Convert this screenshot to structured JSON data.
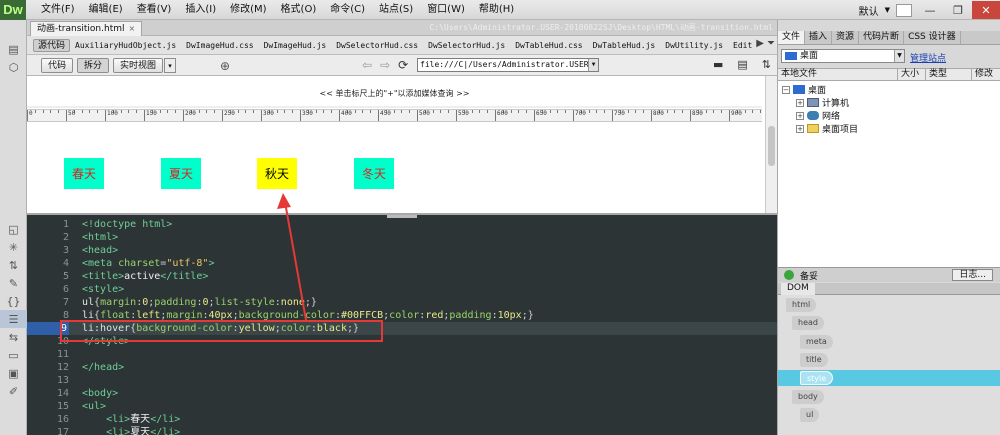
{
  "app": {
    "logo": "Dw",
    "menus": [
      "文件(F)",
      "编辑(E)",
      "查看(V)",
      "插入(I)",
      "修改(M)",
      "格式(O)",
      "命令(C)",
      "站点(S)",
      "窗口(W)",
      "帮助(H)"
    ],
    "workspace": "默认",
    "window_controls": [
      "—",
      "❐",
      "✕"
    ]
  },
  "document": {
    "tab_label": "动画-transition.html",
    "close_glyph": "×",
    "path": "C:\\Users\\Administrator.USER-20180822SJ\\Desktop\\HTML\\动画-transition.html",
    "source_button": "源代码",
    "related_files": [
      "AuxiliaryHudObject.js",
      "DwImageHud.css",
      "DwImageHud.js",
      "DwSelectorHud.css",
      "DwSelectorHud.js",
      "DwTableHud.css",
      "DwTableHud.js",
      "DwUtility.js",
      "Edit"
    ],
    "view_buttons": [
      "代码",
      "拆分",
      "实时视图"
    ],
    "view_dropdown": "▾",
    "url": "file:///C|/Users/Administrator.USER-20",
    "mq_hint": "<< 单击标尺上的\"+\"以添加媒体查询 >>"
  },
  "ruler": {
    "labels": [
      "0",
      "50",
      "100",
      "150",
      "200",
      "250",
      "300",
      "350",
      "400",
      "450",
      "500",
      "550",
      "600",
      "650",
      "700",
      "750",
      "800",
      "850",
      "900",
      "950"
    ]
  },
  "rendered_list": {
    "items": [
      {
        "text": "春天",
        "bg": "#00FFCB",
        "color": "#e02020"
      },
      {
        "text": "夏天",
        "bg": "#00FFCB",
        "color": "#e02020"
      },
      {
        "text": "秋天",
        "bg": "#FFFF00",
        "color": "#000000"
      },
      {
        "text": "冬天",
        "bg": "#00FFCB",
        "color": "#e02020"
      }
    ]
  },
  "code": {
    "highlight_line": 9,
    "lines": [
      {
        "n": "1",
        "segs": [
          [
            "c-tag",
            "<!doctype html>"
          ]
        ]
      },
      {
        "n": "2",
        "segs": [
          [
            "c-tag",
            "<html>"
          ]
        ]
      },
      {
        "n": "3",
        "segs": [
          [
            "c-tag",
            "<head>"
          ]
        ]
      },
      {
        "n": "4",
        "segs": [
          [
            "c-tag",
            "<meta "
          ],
          [
            "c-prop",
            "charset"
          ],
          [
            "c-punc",
            "="
          ],
          [
            "c-str",
            "\"utf-8\""
          ],
          [
            "c-tag",
            ">"
          ]
        ]
      },
      {
        "n": "5",
        "segs": [
          [
            "c-tag",
            "<title>"
          ],
          [
            "c-txt",
            "active"
          ],
          [
            "c-tag",
            "</title>"
          ]
        ]
      },
      {
        "n": "6",
        "segs": [
          [
            "c-tag",
            "<style>"
          ]
        ]
      },
      {
        "n": "7",
        "segs": [
          [
            "c-name",
            "ul"
          ],
          [
            "c-punc",
            "{"
          ],
          [
            "c-prop",
            "margin"
          ],
          [
            "c-punc",
            ":"
          ],
          [
            "c-val",
            "0"
          ],
          [
            "c-punc",
            ";"
          ],
          [
            "c-prop",
            "padding"
          ],
          [
            "c-punc",
            ":"
          ],
          [
            "c-val",
            "0"
          ],
          [
            "c-punc",
            ";"
          ],
          [
            "c-prop",
            "list-style"
          ],
          [
            "c-punc",
            ":"
          ],
          [
            "c-val",
            "none"
          ],
          [
            "c-punc",
            ";}"
          ]
        ]
      },
      {
        "n": "8",
        "segs": [
          [
            "c-name",
            "li"
          ],
          [
            "c-punc",
            "{"
          ],
          [
            "c-prop",
            "float"
          ],
          [
            "c-punc",
            ":"
          ],
          [
            "c-val",
            "left"
          ],
          [
            "c-punc",
            ";"
          ],
          [
            "c-prop",
            "margin"
          ],
          [
            "c-punc",
            ":"
          ],
          [
            "c-val",
            "40px"
          ],
          [
            "c-punc",
            ";"
          ],
          [
            "c-prop",
            "background-color"
          ],
          [
            "c-punc",
            ":"
          ],
          [
            "c-val",
            "#00FFCB"
          ],
          [
            "c-punc",
            ";"
          ],
          [
            "c-prop",
            "color"
          ],
          [
            "c-punc",
            ":"
          ],
          [
            "c-val",
            "red"
          ],
          [
            "c-punc",
            ";"
          ],
          [
            "c-prop",
            "padding"
          ],
          [
            "c-punc",
            ":"
          ],
          [
            "c-val",
            "10px"
          ],
          [
            "c-punc",
            ";}"
          ]
        ]
      },
      {
        "n": "9",
        "segs": [
          [
            "c-name",
            "li:hover"
          ],
          [
            "c-punc",
            "{"
          ],
          [
            "c-prop",
            "background-color"
          ],
          [
            "c-punc",
            ":"
          ],
          [
            "c-val",
            "yellow"
          ],
          [
            "c-punc",
            ";"
          ],
          [
            "c-prop",
            "color"
          ],
          [
            "c-punc",
            ":"
          ],
          [
            "c-val",
            "black"
          ],
          [
            "c-punc",
            ";}"
          ]
        ]
      },
      {
        "n": "10",
        "segs": [
          [
            "c-tag",
            "</style>"
          ]
        ]
      },
      {
        "n": "11",
        "segs": []
      },
      {
        "n": "12",
        "segs": [
          [
            "c-tag",
            "</head>"
          ]
        ]
      },
      {
        "n": "13",
        "segs": []
      },
      {
        "n": "14",
        "segs": [
          [
            "c-tag",
            "<body>"
          ]
        ]
      },
      {
        "n": "15",
        "segs": [
          [
            "c-tag",
            "<ul>"
          ]
        ]
      },
      {
        "n": "16",
        "segs": [
          [
            "c-txt",
            "    "
          ],
          [
            "c-tag",
            "<li>"
          ],
          [
            "c-txt",
            "春天"
          ],
          [
            "c-tag",
            "</li>"
          ]
        ]
      },
      {
        "n": "17",
        "segs": [
          [
            "c-txt",
            "    "
          ],
          [
            "c-tag",
            "<li>"
          ],
          [
            "c-txt",
            "夏天"
          ],
          [
            "c-tag",
            "</li>"
          ]
        ]
      }
    ]
  },
  "right_panel": {
    "tabs": [
      "文件",
      "插入",
      "资源",
      "代码片断",
      "CSS 设计器"
    ],
    "site_select": "桌面",
    "manage_sites": "管理站点",
    "columns": [
      "本地文件",
      "大小",
      "类型",
      "修改"
    ],
    "tree": [
      {
        "label": "桌面",
        "level": 0,
        "icon": "desk",
        "expander": "−"
      },
      {
        "label": "计算机",
        "level": 1,
        "icon": "pc",
        "expander": "+"
      },
      {
        "label": "网络",
        "level": 1,
        "icon": "net",
        "expander": "+"
      },
      {
        "label": "桌面项目",
        "level": 1,
        "icon": "fold",
        "expander": "+"
      }
    ],
    "status": "备妥",
    "log_button": "日志...",
    "dom_tab": "DOM",
    "dom_nodes": [
      "html",
      "head",
      "meta",
      "title",
      "style",
      "body",
      "ul"
    ]
  }
}
